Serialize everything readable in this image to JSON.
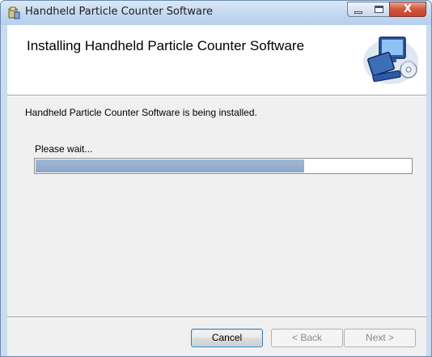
{
  "window": {
    "title": "Handheld Particle Counter Software",
    "close_glyph": "X"
  },
  "banner": {
    "title": "Installing Handheld Particle Counter Software"
  },
  "body": {
    "status_message": "Handheld Particle Counter Software is being installed.",
    "wait_label": "Please wait..."
  },
  "progress": {
    "fraction": 0.715
  },
  "buttons": {
    "cancel": "Cancel",
    "back": "< Back",
    "next": "Next >"
  }
}
